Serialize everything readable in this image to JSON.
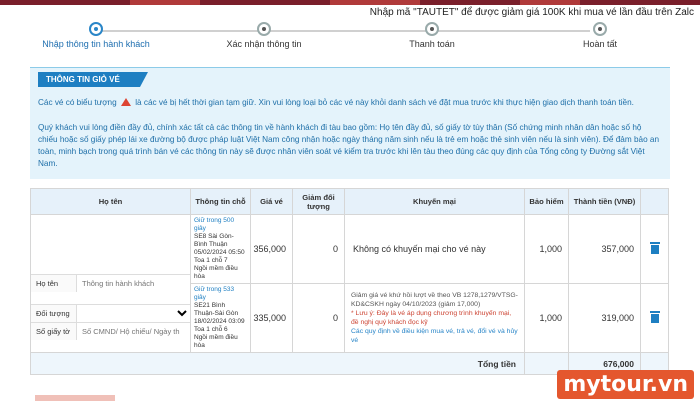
{
  "promo_banner": "Nhập mã \"TAUTET\" để được giảm giá 100K khi mua vé lần đầu trên Zalc",
  "steps": [
    {
      "label": "Nhập thông tin hành khách",
      "active": true
    },
    {
      "label": "Xác nhận thông tin",
      "active": false
    },
    {
      "label": "Thanh toán",
      "active": false
    },
    {
      "label": "Hoàn tất",
      "active": false
    }
  ],
  "cart": {
    "title": "THÔNG TIN GIỎ VÉ",
    "notice_1_pre": "Các vé có biểu tượng",
    "notice_1_post": "là các vé bị hết thời gian tạm giữ. Xin vui lòng loại bỏ các vé này khỏi danh sách vé đặt mua trước khi thực hiện giao dịch thanh toán tiền.",
    "notice_2": "Quý khách vui lòng điền đầy đủ, chính xác tất cả các thông tin về hành khách đi tàu bao gồm: Họ tên đầy đủ, số giấy tờ tùy thân (Số chứng minh nhân dân hoặc số hộ chiếu hoặc số giấy phép lái xe đường bộ được pháp luật Việt Nam công nhận hoặc ngày tháng năm sinh nếu là trẻ em hoặc thẻ sinh viên nếu là sinh viên). Để đảm bảo an toàn, minh bạch trong quá trình bán vé các thông tin này sẽ được nhân viên soát vé kiểm tra trước khi lên tàu theo đúng các quy định của Tổng công ty Đường sắt Việt Nam."
  },
  "table": {
    "headers": {
      "name": "Họ tên",
      "seat": "Thông tin chỗ",
      "price": "Giá vé",
      "discount": "Giảm đối tượng",
      "promo": "Khuyến mại",
      "insurance": "Bảo hiểm",
      "total": "Thành tiền (VNĐ)"
    },
    "rows": [
      {
        "hold": "Giữ trong 500 giây",
        "seat_lines": [
          "SE8 Sài Gòn-Bình Thuận",
          "05/02/2024 05:50",
          "Toa 1 chỗ 7",
          "Ngồi mềm điều hòa"
        ],
        "price": "356,000",
        "discount": "0",
        "promo": "Không có khuyến mại cho vé này",
        "insurance": "1,000",
        "total": "357,000"
      },
      {
        "hold": "Giữ trong 533 giây",
        "seat_lines": [
          "SE21 Bình Thuận-Sài Gòn",
          "18/02/2024 03:09",
          "Toa 1 chỗ 6",
          "Ngồi mềm điều hòa"
        ],
        "price": "335,000",
        "discount": "0",
        "promo_main": "Giảm giá vé khứ hồi lượt về theo VB 1278,1279/VTSG-KD&CSKH ngày 04/10/2023 (giảm 17,000)",
        "promo_note": "* Lưu ý: Đây là vé áp dụng chương trình khuyến mại, đề nghị quý khách đọc kỹ",
        "promo_link": "Các quy định về điều kiện mua vé, trả vé, đổi vé và hủy vé",
        "insurance": "1,000",
        "total": "319,000"
      }
    ],
    "fields": {
      "name_label": "Họ tên",
      "name_placeholder": "Thông tin hành khách",
      "type_label": "Đối tượng",
      "id_label": "Số giấy tờ",
      "id_placeholder": "Số CMND/ Hộ chiếu/ Ngày th"
    },
    "total_label": "Tổng tiền",
    "total_value": "676,000"
  },
  "watermark": "mytour.vn"
}
